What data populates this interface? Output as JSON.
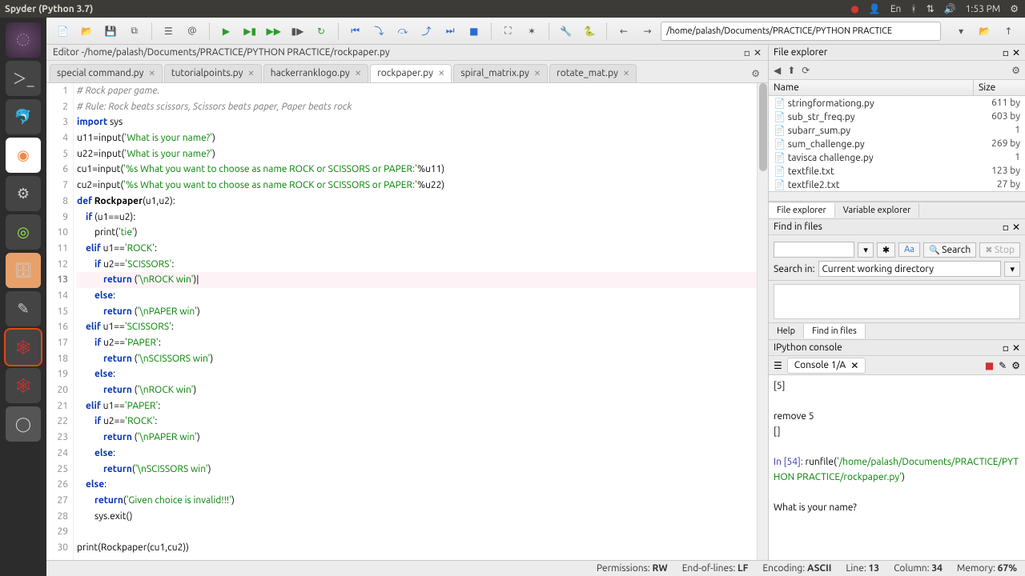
{
  "window": {
    "title": "Spyder (Python 3.7)"
  },
  "menubar": {
    "time": "1:53 PM",
    "lang": "En"
  },
  "toolbar": {
    "path_value": "/home/palash/Documents/PRACTICE/PYTHON PRACTICE"
  },
  "editor": {
    "title_prefix": "Editor - ",
    "title_path": "/home/palash/Documents/PRACTICE/PYTHON PRACTICE/rockpaper.py",
    "tabs": [
      {
        "label": "special command.py"
      },
      {
        "label": "tutorialpoints.py"
      },
      {
        "label": "hackerranklogo.py"
      },
      {
        "label": "rockpaper.py",
        "active": true
      },
      {
        "label": "spiral_matrix.py"
      },
      {
        "label": "rotate_mat.py"
      }
    ],
    "current_line": 13,
    "code": [
      {
        "n": 1,
        "segs": [
          [
            "c-comment",
            "# Rock paper game."
          ]
        ]
      },
      {
        "n": 2,
        "segs": [
          [
            "c-comment",
            "# Rule: Rock beats scissors, Scissors beats paper, Paper beats rock"
          ]
        ]
      },
      {
        "n": 3,
        "segs": [
          [
            "c-kw",
            "import"
          ],
          "",
          " sys"
        ]
      },
      {
        "n": 4,
        "segs": [
          "u11=input(",
          [
            "c-str",
            "'What is your name?'"
          ],
          ")"
        ]
      },
      {
        "n": 5,
        "segs": [
          "u22=input(",
          [
            "c-str",
            "'What is your name?'"
          ],
          ")"
        ]
      },
      {
        "n": 6,
        "segs": [
          "cu1=input(",
          [
            "c-str",
            "'%s What you want to choose as name ROCK or SCISSORS or PAPER:'"
          ],
          "%u11)"
        ]
      },
      {
        "n": 7,
        "segs": [
          "cu2=input(",
          [
            "c-str",
            "'%s What you want to choose as name ROCK or SCISSORS or PAPER:'"
          ],
          "%u22)"
        ]
      },
      {
        "n": 8,
        "segs": [
          [
            "c-kw",
            "def"
          ],
          " ",
          [
            "c-fn",
            "Rockpaper"
          ],
          "(u1,u2):"
        ]
      },
      {
        "n": 9,
        "segs": [
          "    ",
          [
            "c-kw",
            "if"
          ],
          " (u1==u2):"
        ]
      },
      {
        "n": 10,
        "segs": [
          "        print(",
          [
            "c-str",
            "'tie'"
          ],
          ")"
        ]
      },
      {
        "n": 11,
        "segs": [
          "    ",
          [
            "c-kw",
            "elif"
          ],
          " u1==",
          [
            "c-str",
            "'ROCK'"
          ],
          ":"
        ]
      },
      {
        "n": 12,
        "segs": [
          "        ",
          [
            "c-kw",
            "if"
          ],
          " u2==",
          [
            "c-str",
            "'SCISSORS'"
          ],
          ":"
        ]
      },
      {
        "n": 13,
        "segs": [
          "            ",
          [
            "c-kw",
            "return"
          ],
          " (",
          [
            "c-str",
            "'\\nROCK win'"
          ],
          ")|"
        ]
      },
      {
        "n": 14,
        "segs": [
          "        ",
          [
            "c-kw",
            "else"
          ],
          ":"
        ]
      },
      {
        "n": 15,
        "segs": [
          "            ",
          [
            "c-kw",
            "return"
          ],
          " (",
          [
            "c-str",
            "'\\nPAPER win'"
          ],
          ")"
        ]
      },
      {
        "n": 16,
        "segs": [
          "    ",
          [
            "c-kw",
            "elif"
          ],
          " u1==",
          [
            "c-str",
            "'SCISSORS'"
          ],
          ":"
        ]
      },
      {
        "n": 17,
        "segs": [
          "        ",
          [
            "c-kw",
            "if"
          ],
          " u2==",
          [
            "c-str",
            "'PAPER'"
          ],
          ":"
        ]
      },
      {
        "n": 18,
        "segs": [
          "            ",
          [
            "c-kw",
            "return"
          ],
          " (",
          [
            "c-str",
            "'\\nSCISSORS win'"
          ],
          ")"
        ]
      },
      {
        "n": 19,
        "segs": [
          "        ",
          [
            "c-kw",
            "else"
          ],
          ":"
        ]
      },
      {
        "n": 20,
        "segs": [
          "            ",
          [
            "c-kw",
            "return"
          ],
          " (",
          [
            "c-str",
            "'\\nROCK win'"
          ],
          ")"
        ]
      },
      {
        "n": 21,
        "segs": [
          "    ",
          [
            "c-kw",
            "elif"
          ],
          " u1==",
          [
            "c-str",
            "'PAPER'"
          ],
          ":"
        ]
      },
      {
        "n": 22,
        "segs": [
          "        ",
          [
            "c-kw",
            "if"
          ],
          " u2==",
          [
            "c-str",
            "'ROCK'"
          ],
          ":"
        ]
      },
      {
        "n": 23,
        "segs": [
          "            ",
          [
            "c-kw",
            "return"
          ],
          " (",
          [
            "c-str",
            "'\\nPAPER win'"
          ],
          ")"
        ]
      },
      {
        "n": 24,
        "segs": [
          "        ",
          [
            "c-kw",
            "else"
          ],
          ":"
        ]
      },
      {
        "n": 25,
        "segs": [
          "            ",
          [
            "c-kw",
            "return"
          ],
          "(",
          [
            "c-str",
            "'\\nSCISSORS win'"
          ],
          ")"
        ]
      },
      {
        "n": 26,
        "segs": [
          "    ",
          [
            "c-kw",
            "else"
          ],
          ":"
        ]
      },
      {
        "n": 27,
        "segs": [
          "        ",
          [
            "c-kw",
            "return"
          ],
          "(",
          [
            "c-str",
            "'Given choice is invalid!!!'"
          ],
          ")"
        ]
      },
      {
        "n": 28,
        "segs": [
          "        sys.exit()"
        ]
      },
      {
        "n": 29,
        "segs": [
          ""
        ]
      },
      {
        "n": 30,
        "segs": [
          "print(Rockpaper(cu1,cu2))"
        ]
      }
    ]
  },
  "file_explorer": {
    "title": "File explorer",
    "columns": {
      "name": "Name",
      "size": "Size"
    },
    "files": [
      {
        "name": "stringformationg.py",
        "size": "611 by"
      },
      {
        "name": "sub_str_freq.py",
        "size": "603 by"
      },
      {
        "name": "subarr_sum.py",
        "size": "1"
      },
      {
        "name": "sum_challenge.py",
        "size": "269 by"
      },
      {
        "name": "tavisca challenge.py",
        "size": "1"
      },
      {
        "name": "textfile.txt",
        "size": "123 by"
      },
      {
        "name": "textfile2.txt",
        "size": "27 by"
      }
    ],
    "bottom_tabs": {
      "file": "File explorer",
      "var": "Variable explorer"
    }
  },
  "find": {
    "title": "Find in files",
    "search_label": "Search",
    "stop_label": "Stop",
    "search_in_label": "Search in:",
    "search_in_value": "Current working directory",
    "tab_help": "Help",
    "tab_find": "Find in files"
  },
  "console": {
    "title": "IPython console",
    "tab_label": "Console 1/A",
    "out_bracket": "[5]",
    "remove_line": "remove 5",
    "empty_list": "[]",
    "in_prefix": "In [54]: ",
    "runfile_call": "runfile(",
    "runfile_path": "'/home/palash/Documents/PRACTICE/PYTHON PRACTICE/rockpaper.py'",
    "runfile_close": ")",
    "prompt": "What is your name?"
  },
  "statusbar": {
    "perm_label": "Permissions:",
    "perm_value": "RW",
    "eol_label": "End-of-lines:",
    "eol_value": "LF",
    "enc_label": "Encoding:",
    "enc_value": "ASCII",
    "line_label": "Line:",
    "line_value": "13",
    "col_label": "Column:",
    "col_value": "34",
    "mem_label": "Memory:",
    "mem_value": "67%"
  }
}
